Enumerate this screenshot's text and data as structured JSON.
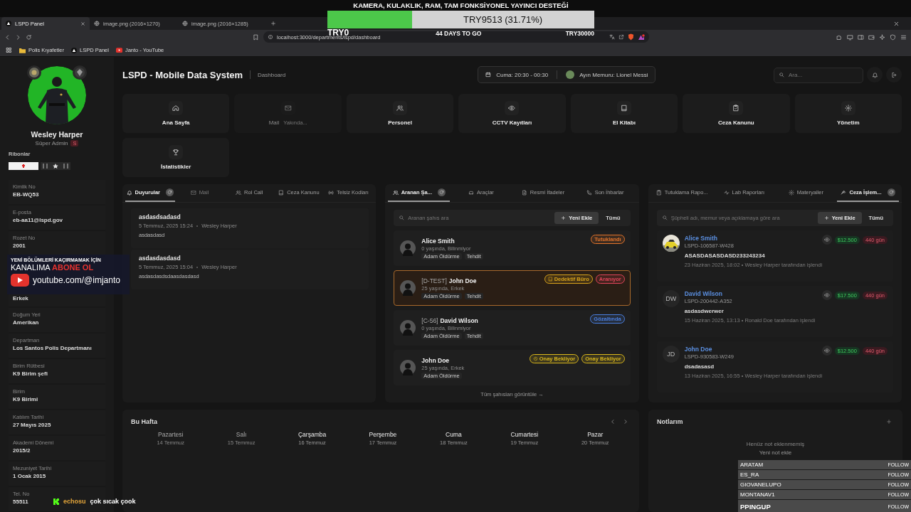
{
  "stream_overlay": {
    "goal": {
      "title": "KAMERA, KULAKLIK, RAM, TAM FONKSİYONEL YAYINCI DESTEĞİ",
      "amount": "TRY9513 (31.71%)",
      "level": 0.3171,
      "start": "TRY0",
      "days_left": "44 DAYS TO GO",
      "target": "TRY30000"
    },
    "subscribe_banner": {
      "line_1": "YENİ BÖLÜMLERİ KAÇIRMAMAK İÇİN",
      "line_2": "KANALIMA **ABONE OL**",
      "channel": "youtube.com/@imjanto"
    },
    "chat_message": {
      "user": "echosu",
      "text": "çok sıcak çook"
    },
    "followers": [
      {
        "name": "ARATAM",
        "action": "FOLLOW"
      },
      {
        "name": "ES_RA",
        "action": "FOLLOW"
      },
      {
        "name": "GIOVANELUPO",
        "action": "FOLLOW"
      },
      {
        "name": "MONTANAV1",
        "action": "FOLLOW"
      },
      {
        "name": "PPINGUP",
        "action": "FOLLOW"
      }
    ]
  },
  "browser": {
    "tabs": [
      {
        "title": "LSPD Panel",
        "selected": true
      },
      {
        "title": "image.png (2016×1270)",
        "selected": false
      },
      {
        "title": "image.png (2016×1285)",
        "selected": false
      }
    ],
    "url": "localhost:3000/departments/lspd/dashboard",
    "bookmarks": [
      {
        "label": "Polis Kıyafetler"
      },
      {
        "label": "LSPD Panel"
      },
      {
        "label": "Janto - YouTube"
      }
    ]
  },
  "profile": {
    "name": "Wesley Harper",
    "role": "Süper Admin",
    "role_badge": "S",
    "ribbons_label": "Ribonlar",
    "fields": [
      {
        "label": "Kimlik No",
        "value": "EB-WQ53"
      },
      {
        "label": "E-posta",
        "value": "eb-aa11@lspd.gov"
      },
      {
        "label": "Rozet No",
        "value": "2001"
      },
      {
        "value": "Erkek"
      },
      {
        "label": "Doğum Yeri",
        "value": "Amerikan"
      },
      {
        "label": "Departman",
        "value": "Los Santos Polis Departmanı"
      },
      {
        "label": "Birim Rütbesi",
        "value": "K9 Birim şefi"
      },
      {
        "label": "Birim",
        "value": "K9 Birimi"
      },
      {
        "label": "Katılım Tarihi",
        "value": "27 Mayıs 2025"
      },
      {
        "label": "Akademi Dönemi",
        "value": "2015/2"
      },
      {
        "label": "Mezuniyet Tarihi",
        "value": "1 Ocak 2015"
      },
      {
        "label": "Tel. No",
        "value": "55511"
      }
    ]
  },
  "header": {
    "title": "LSPD - Mobile Data System",
    "breadcrumb": "Dashboard",
    "shift": "Cuma: 20:30 - 00:30",
    "officer_of_month": "Ayın Memuru: Lionel Messi",
    "search_placeholder": "Ara..."
  },
  "nav": [
    {
      "label": "Ana Sayfa",
      "disabled": false
    },
    {
      "label": "Mail",
      "disabled": true,
      "note": "Yakında..."
    },
    {
      "label": "Personel",
      "disabled": false
    },
    {
      "label": "CCTV Kayıtları",
      "disabled": false
    },
    {
      "label": "El Kitabı",
      "disabled": false
    },
    {
      "label": "Ceza Kanunu",
      "disabled": false
    },
    {
      "label": "Yönetim",
      "disabled": false
    },
    {
      "label": "İstatistikler",
      "disabled": false
    }
  ],
  "announcements_panel": {
    "tabs": [
      {
        "label": "Duyurular",
        "selected": true,
        "disabled": false
      },
      {
        "label": "Mail",
        "selected": false,
        "disabled": true
      },
      {
        "label": "Rol Call",
        "selected": false,
        "disabled": false
      },
      {
        "label": "Ceza Kanunu",
        "selected": false,
        "disabled": false
      },
      {
        "label": "Telsiz Kodları",
        "selected": false,
        "disabled": false
      }
    ],
    "items": [
      {
        "title": "asdasdsadasd",
        "date": "5 Temmuz, 2025 15:24",
        "author": "Wesley Harper",
        "body": "asdasdasd"
      },
      {
        "title": "asdasdasdasd",
        "date": "5 Temmuz, 2025 15:04",
        "author": "Wesley Harper",
        "body": "asdasdasdsdaasdasdasd"
      }
    ]
  },
  "wanted_panel": {
    "tabs": [
      {
        "label": "Aranan Şa...",
        "selected": true
      },
      {
        "label": "Araçlar",
        "selected": false
      },
      {
        "label": "Resmi İfadeler",
        "selected": false
      },
      {
        "label": "Son İhbarlar",
        "selected": false
      }
    ],
    "search_placeholder": "Aranan şahıs ara",
    "add_button": "Yeni Ekle",
    "filter_button": "Tümü",
    "people": [
      {
        "name": "Alice Smith",
        "meta": "0 yaşında, Bilinmiyor",
        "tags": [
          "Adam Öldürme",
          "Tehdit"
        ],
        "selected": false,
        "badges": [
          {
            "kind": "status",
            "label": "Tutuklandı",
            "color": "#e2742b"
          }
        ]
      },
      {
        "prefix": "[D-TEST]",
        "name": "John Doe",
        "meta": "25 yaşında, Erkek",
        "tags": [
          "Adam Öldürme",
          "Tehdit"
        ],
        "selected": true,
        "badges": [
          {
            "kind": "department",
            "label": "Dedektif Büro",
            "color": "#d8a31c"
          },
          {
            "kind": "status",
            "label": "Aranıyor",
            "color": "#e0455a"
          }
        ]
      },
      {
        "prefix": "[C-56]",
        "name": "David Wilson",
        "meta": "0 yaşında, Bilinmiyor",
        "tags": [
          "Adam Öldürme",
          "Tehdit"
        ],
        "selected": false,
        "badges": [
          {
            "kind": "status",
            "label": "Gözaltında",
            "color": "#4a7fe0"
          }
        ]
      },
      {
        "name": "John Doe",
        "meta": "25 yaşında, Erkek",
        "tags": [
          "Adam Öldürme"
        ],
        "selected": false,
        "badges": [
          {
            "kind": "pending",
            "label": "Onay Bekliyor",
            "color": "#d8b61c"
          },
          {
            "kind": "status",
            "label": "Onay Bekliyor",
            "color": "#d8b61c"
          }
        ]
      }
    ],
    "footer_link": "Tüm şahısları görüntüle →"
  },
  "fines_panel": {
    "tabs": [
      {
        "label": "Tutuklama Rapo...",
        "selected": false
      },
      {
        "label": "Lab Raporları",
        "selected": false
      },
      {
        "label": "Materyaller",
        "selected": false
      },
      {
        "label": "Ceza İşlem...",
        "selected": true
      }
    ],
    "search_placeholder": "Şüpheli adı, memur veya açıklamaya göre ara",
    "add_button": "Yeni Ekle",
    "filter_button": "Tümü",
    "records": [
      {
        "name": "Alice Smith",
        "record_id": "LSPD-106587-W428",
        "description": "ASASDASASDASD233243234",
        "meta": "23 Haziran 2025, 18:02 • Wesley Harper tarafından işlendi",
        "fine": "$12.500",
        "sentence": "440 gün"
      },
      {
        "avatar": {
          "kind": "initials",
          "text": "DW"
        },
        "name": "David Wilson",
        "record_id": "LSPD-200442-A352",
        "description": "asdasdwerwer",
        "meta": "15 Haziran 2025, 13:13 • Ronald Doe tarafından işlendi",
        "fine": "$17.500",
        "sentence": "440 gün"
      },
      {
        "avatar": {
          "kind": "initials",
          "text": "JD"
        },
        "name": "John Doe",
        "record_id": "LSPD-930583-W249",
        "description": "dsadasasd",
        "meta": "13 Haziran 2025, 16:55 • Wesley Harper tarafından işlendi",
        "fine": "$12.500",
        "sentence": "440 gün"
      }
    ]
  },
  "week": {
    "title": "Bu Hafta",
    "days": [
      {
        "name": "Pazartesi",
        "date": "14 Temmuz",
        "past": true
      },
      {
        "name": "Salı",
        "date": "15 Temmuz",
        "past": true
      },
      {
        "name": "Çarşamba",
        "date": "16 Temmuz",
        "past": false
      },
      {
        "name": "Perşembe",
        "date": "17 Temmuz",
        "past": false
      },
      {
        "name": "Cuma",
        "date": "18 Temmuz",
        "past": false
      },
      {
        "name": "Cumartesi",
        "date": "19 Temmuz",
        "past": false
      },
      {
        "name": "Pazar",
        "date": "20 Temmuz",
        "past": false
      }
    ]
  },
  "notes": {
    "title": "Notlarım",
    "empty_text": "Henüz not eklenmemiş",
    "add_link": "Yeni not ekle"
  }
}
